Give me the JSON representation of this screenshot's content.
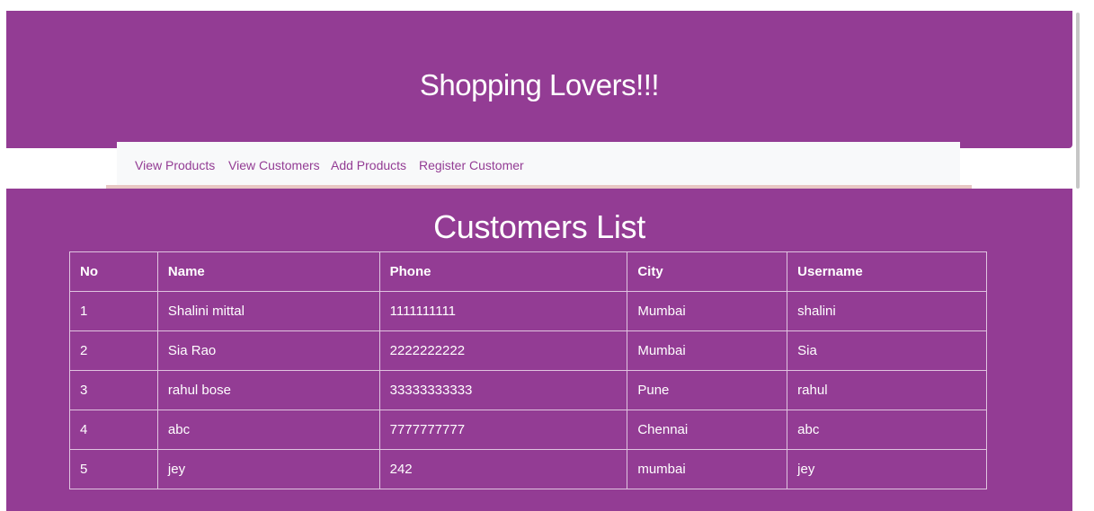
{
  "header": {
    "title": "Shopping Lovers!!!",
    "background_color": "#933c94"
  },
  "nav": {
    "items": [
      {
        "label": "View Products"
      },
      {
        "label": "View Customers"
      },
      {
        "label": "Add Products"
      },
      {
        "label": "Register Customer"
      }
    ],
    "link_color": "#933c94",
    "background_color": "#f8f9fa"
  },
  "main": {
    "title": "Customers List",
    "background_color": "#933c94"
  },
  "table": {
    "columns": [
      "No",
      "Name",
      "Phone",
      "City",
      "Username"
    ],
    "rows": [
      [
        "1",
        "Shalini mittal",
        "1111111111",
        "Mumbai",
        "shalini"
      ],
      [
        "2",
        "Sia Rao",
        "2222222222",
        "Mumbai",
        "Sia"
      ],
      [
        "3",
        "rahul bose",
        "33333333333",
        "Pune",
        "rahul"
      ],
      [
        "4",
        "abc",
        "7777777777",
        "Chennai",
        "abc"
      ],
      [
        "5",
        "jey",
        "242",
        "mumbai",
        "jey"
      ]
    ]
  }
}
